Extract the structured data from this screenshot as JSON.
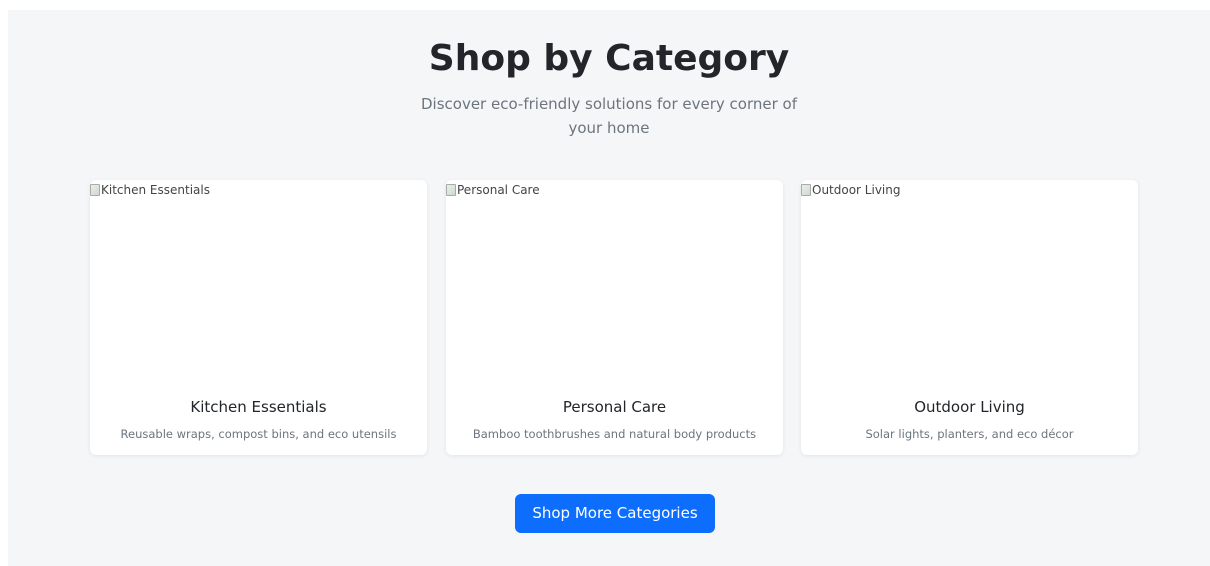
{
  "section": {
    "title": "Shop by Category",
    "subtitle": "Discover eco-friendly solutions for every corner of your home"
  },
  "categories": [
    {
      "image_alt": "Kitchen Essentials",
      "title": "Kitchen Essentials",
      "description": "Reusable wraps, compost bins, and eco utensils"
    },
    {
      "image_alt": "Personal Care",
      "title": "Personal Care",
      "description": "Bamboo toothbrushes and natural body products"
    },
    {
      "image_alt": "Outdoor Living",
      "title": "Outdoor Living",
      "description": "Solar lights, planters, and eco décor"
    }
  ],
  "cta": {
    "label": "Shop More Categories"
  },
  "colors": {
    "background": "#f5f6f8",
    "card": "#ffffff",
    "accent": "#0d6efd",
    "heading": "#222529",
    "muted": "#6c757d"
  },
  "icons": {
    "image_placeholder": "broken-image-icon"
  }
}
